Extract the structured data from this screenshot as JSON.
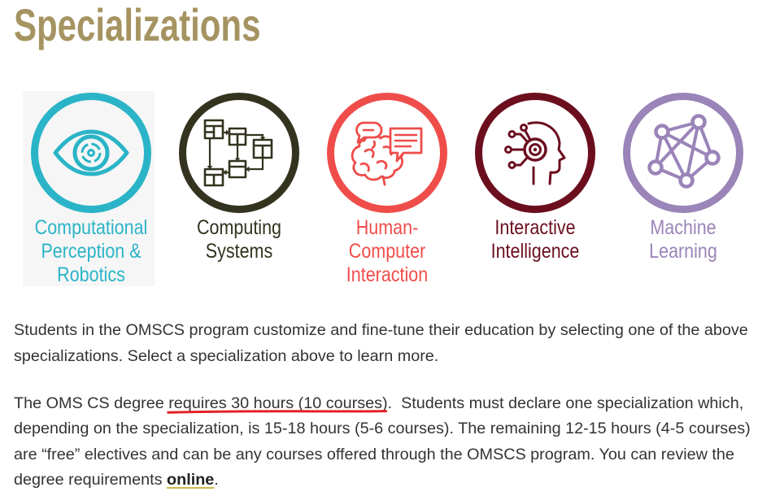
{
  "page": {
    "title": "Specializations"
  },
  "colors": {
    "title": "#a59461",
    "body_text": "#333333",
    "link_text": "#222222",
    "link_underline": "#d1b64e",
    "annotation": "#e32129"
  },
  "specializations": {
    "items": [
      {
        "label": "Computational Perception & Robotics",
        "color": "#2bb4c7",
        "icon": "eye-icon"
      },
      {
        "label": "Computing Systems",
        "color": "#33331f",
        "icon": "flowchart-icon"
      },
      {
        "label": "Human-Computer Interaction",
        "color": "#ef4d4a",
        "icon": "brain-speech-bubbles-icon"
      },
      {
        "label": "Interactive Intelligence",
        "color": "#6b0e1e",
        "icon": "ai-head-circuit-icon"
      },
      {
        "label": "Machine Learning",
        "color": "#9a84b8",
        "icon": "neural-network-icon"
      }
    ]
  },
  "content": {
    "paragraph_1": "Students in the OMSCS program customize and fine-tune their education by selecting one of the above specializations. Select a specialization above to learn more.",
    "paragraph_2": {
      "lead": "The OMS CS degree ",
      "highlight": "requires 30 hours (10 courses)",
      "middle": ".  Students must declare one specialization which, depending on the specialization, is 15-18 hours (5-6 courses). The remaining 12-15 hours (4-5 courses) are “free” electives and can be any courses offered through the OMSCS program. You can review the degree requirements ",
      "link_text": "online",
      "end": "."
    }
  }
}
